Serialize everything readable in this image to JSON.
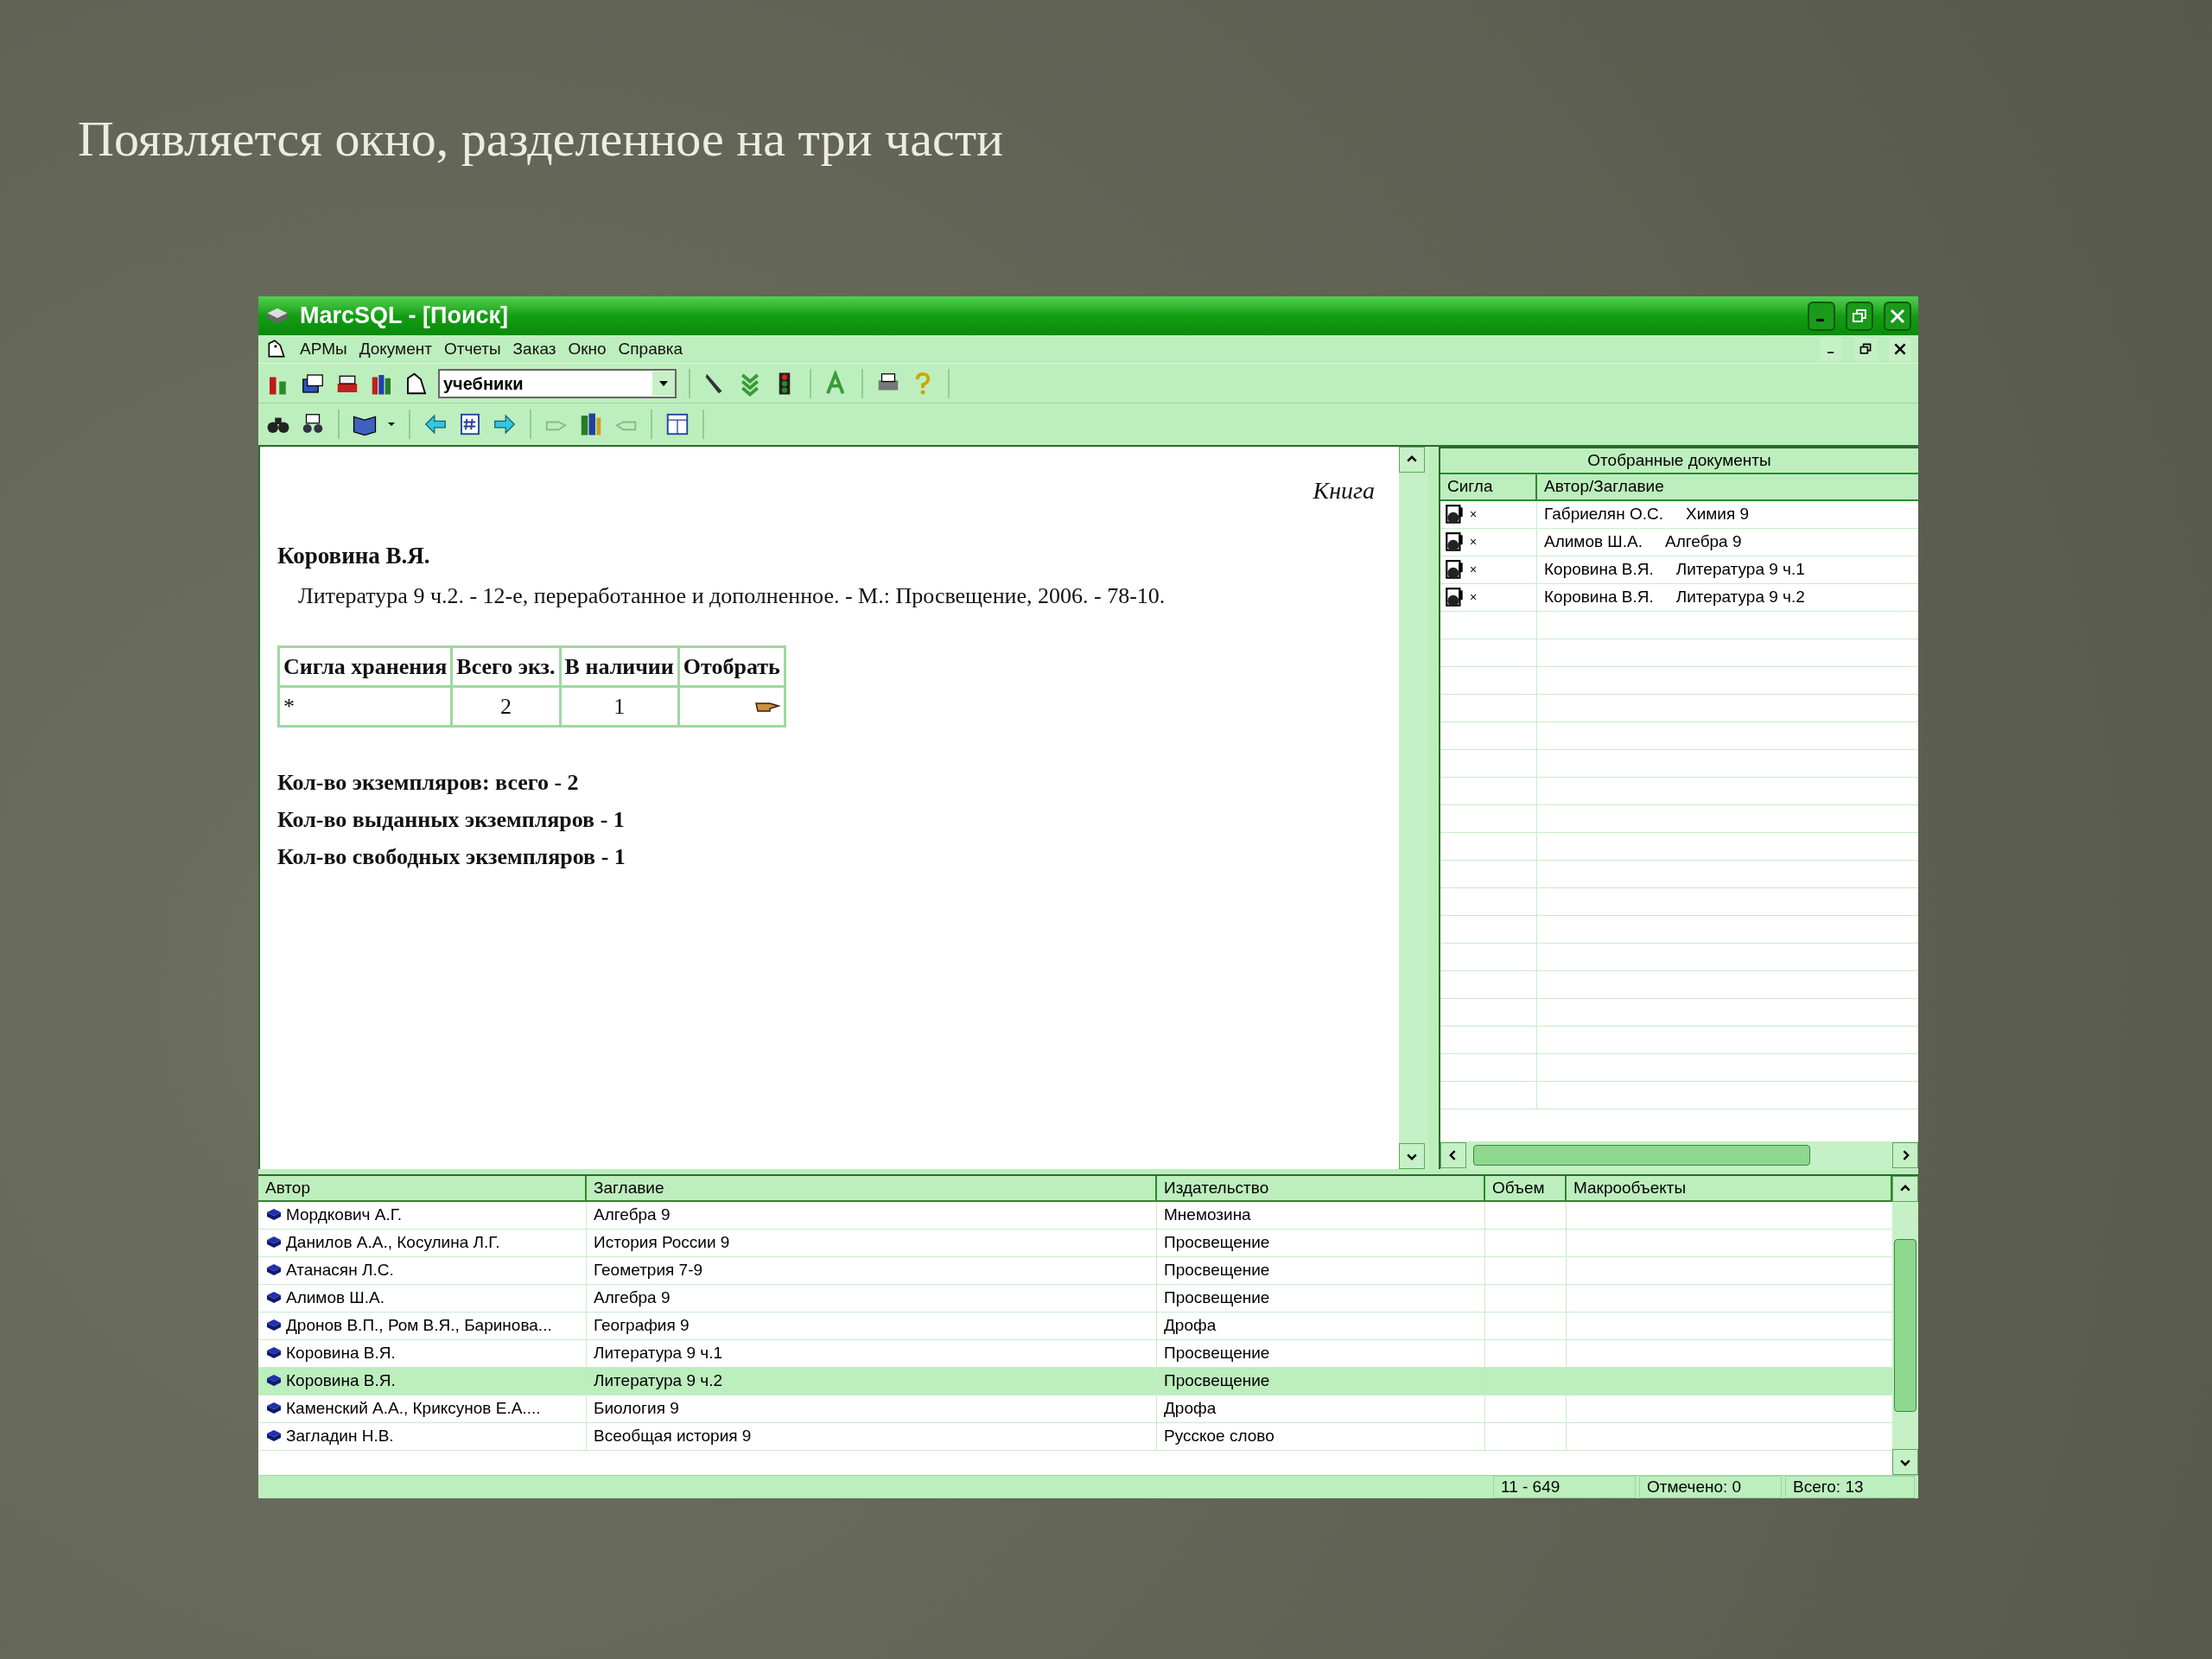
{
  "slide": {
    "title": "Появляется окно, разделенное на три части"
  },
  "window": {
    "title": "MarcSQL - [Поиск]"
  },
  "menu": [
    "АРМы",
    "Документ",
    "Отчеты",
    "Заказ",
    "Окно",
    "Справка"
  ],
  "toolbar": {
    "search_combo": {
      "value": "учебники"
    }
  },
  "record": {
    "type_label": "Книга",
    "author": "Коровина В.Я.",
    "description": "Литература 9 ч.2. - 12-е, переработанное и дополненное. - М.: Просвещение, 2006. - 78-10.",
    "holdings": {
      "columns": [
        "Сигла хранения",
        "Всего экз.",
        "В наличии",
        "Отобрать"
      ],
      "rows": [
        [
          "*",
          "2",
          "1"
        ]
      ]
    },
    "summary": [
      "Кол-во экземпляров: всего - 2",
      "Кол-во выданных экземпляров - 1",
      "Кол-во свободных экземпляров - 1"
    ]
  },
  "selected_docs": {
    "title": "Отобранные документы",
    "columns": [
      "Сигла",
      "Автор/Заглавие"
    ],
    "rows": [
      {
        "mark": "×",
        "author": "Габриелян О.С.",
        "title": "Химия 9"
      },
      {
        "mark": "×",
        "author": "Алимов Ш.А.",
        "title": "Алгебра 9"
      },
      {
        "mark": "×",
        "author": "Коровина В.Я.",
        "title": "Литература 9 ч.1"
      },
      {
        "mark": "×",
        "author": "Коровина В.Я.",
        "title": "Литература 9 ч.2"
      }
    ]
  },
  "results": {
    "columns": [
      "Автор",
      "Заглавие",
      "Издательство",
      "Объем",
      "Макрообъекты"
    ],
    "rows": [
      {
        "author": "Мордкович А.Г.",
        "title": "Алгебра 9",
        "publisher": "Мнемозина",
        "selected": false
      },
      {
        "author": "Данилов А.А., Косулина Л.Г.",
        "title": "История России 9",
        "publisher": "Просвещение",
        "selected": false
      },
      {
        "author": "Атанасян Л.С.",
        "title": "Геометрия 7-9",
        "publisher": "Просвещение",
        "selected": false
      },
      {
        "author": "Алимов Ш.А.",
        "title": "Алгебра 9",
        "publisher": "Просвещение",
        "selected": false
      },
      {
        "author": "Дронов В.П., Ром В.Я., Баринова...",
        "title": "География 9",
        "publisher": "Дрофа",
        "selected": false
      },
      {
        "author": "Коровина В.Я.",
        "title": "Литература 9 ч.1",
        "publisher": "Просвещение",
        "selected": false
      },
      {
        "author": "Коровина В.Я.",
        "title": "Литература 9 ч.2",
        "publisher": "Просвещение",
        "selected": true
      },
      {
        "author": "Каменский А.А., Криксунов Е.А....",
        "title": "Биология 9",
        "publisher": "Дрофа",
        "selected": false
      },
      {
        "author": "Загладин Н.В.",
        "title": "Всеобщая история 9",
        "publisher": "Русское слово",
        "selected": false
      }
    ]
  },
  "status_bar": [
    "11 - 649",
    "Отмечено: 0",
    "Всего: 13"
  ]
}
